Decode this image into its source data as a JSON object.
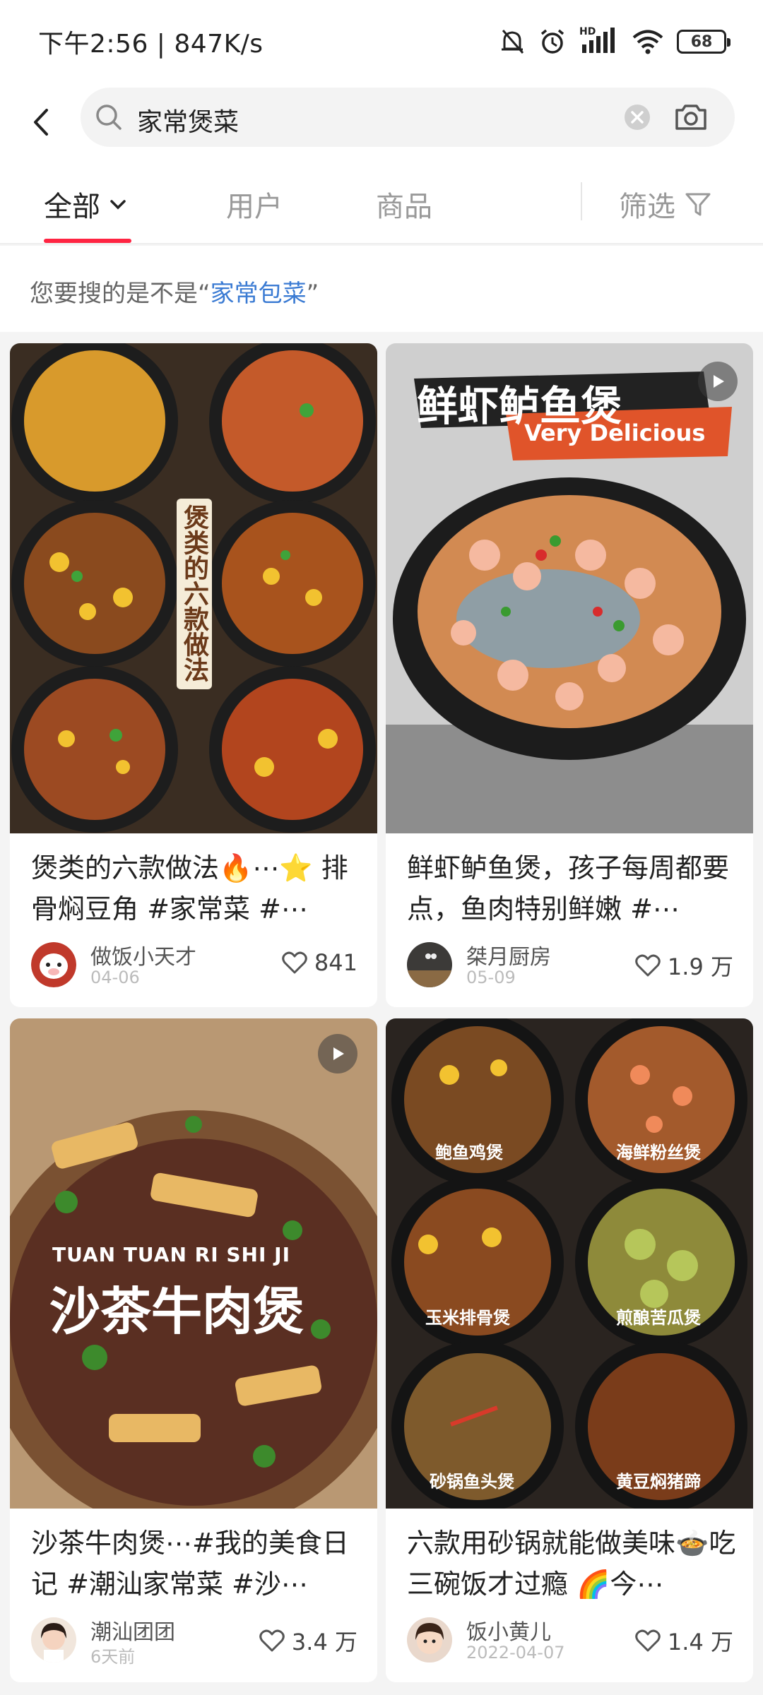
{
  "status_bar": {
    "time_speed": "下午2:56 | 847K/s",
    "network": "HD",
    "battery": "68"
  },
  "search": {
    "query": "家常煲菜"
  },
  "tabs": {
    "all": "全部",
    "users": "用户",
    "goods": "商品",
    "filter": "筛选"
  },
  "suggestion": {
    "prefix": "您要搜的是不是“",
    "keyword": "家常包菜",
    "suffix": "”"
  },
  "cards": [
    {
      "title": "煲类的六款做法🔥⋯⭐ 排骨焖豆角 #家常菜 #⋯",
      "overlay": "煲类的六款做法",
      "author": "做饭小天才",
      "date": "04-06",
      "likes": "841"
    },
    {
      "title": "鲜虾鲈鱼煲，孩子每周都要点，鱼肉特别鲜嫩 #⋯",
      "overlay": "鲜虾鲈鱼煲",
      "overlay_sub": "Very Delicious",
      "author": "桀月厨房",
      "date": "05-09",
      "likes": "1.9 万"
    },
    {
      "title": "沙茶牛肉煲⋯#我的美食日记 #潮汕家常菜 #沙⋯",
      "overlay_en": "TUAN TUAN RI SHI JI",
      "overlay": "沙茶牛肉煲",
      "author": "潮汕团团",
      "date": "6天前",
      "likes": "3.4 万"
    },
    {
      "title": "六款用砂锅就能做美味🍲吃三碗饭才过瘾 🌈今⋯",
      "dishes": [
        "鲍鱼鸡煲",
        "海鲜粉丝煲",
        "玉米排骨煲",
        "煎酿苦瓜煲",
        "砂锅鱼头煲",
        "黄豆焖猪蹄"
      ],
      "author": "饭小黄儿",
      "date": "2022-04-07",
      "likes": "1.4 万"
    }
  ],
  "colors": {
    "accent": "#ff2442",
    "link": "#3b7bd3"
  }
}
